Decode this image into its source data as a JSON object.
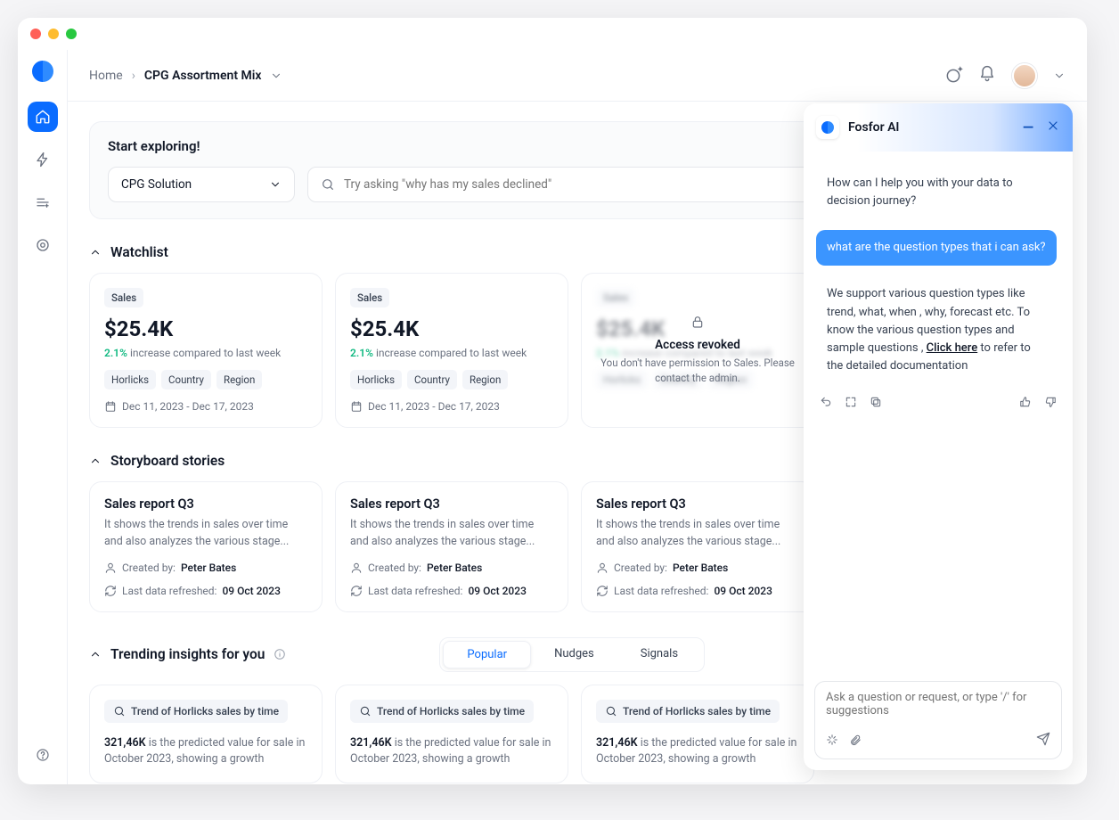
{
  "breadcrumb": {
    "home": "Home",
    "current": "CPG Assortment Mix"
  },
  "explore": {
    "title": "Start exploring!",
    "dropdown_value": "CPG Solution",
    "search_placeholder": "Try asking \"why has my sales declined\""
  },
  "watchlist": {
    "title": "Watchlist",
    "cards": [
      {
        "tag": "Sales",
        "value": "$25.4K",
        "pct": "2.1%",
        "caption": "increase compared to last week",
        "chips": [
          "Horlicks",
          "Country",
          "Region"
        ],
        "dates": "Dec 11, 2023 - Dec 17, 2023"
      },
      {
        "tag": "Sales",
        "value": "$25.4K",
        "pct": "2.1%",
        "caption": "increase compared to last week",
        "chips": [
          "Horlicks",
          "Country",
          "Region"
        ],
        "dates": "Dec 11, 2023 - Dec 17, 2023"
      },
      {
        "tag": "Sales",
        "locked": true,
        "lock_title": "Access revoked",
        "lock_sub": "You don't have permission to Sales. Please contact the admin."
      }
    ]
  },
  "storyboard": {
    "title": "Storyboard stories",
    "cards": [
      {
        "title": "Sales report Q3",
        "desc": "It shows the trends in sales over time and also analyzes the various stage...",
        "created_label": "Created by:",
        "created_by": "Peter Bates",
        "refreshed_label": "Last data refreshed:",
        "refreshed": "09 Oct 2023"
      },
      {
        "title": "Sales report Q3",
        "desc": "It shows the trends in sales over time and also analyzes the various stage...",
        "created_label": "Created by:",
        "created_by": "Peter Bates",
        "refreshed_label": "Last data refreshed:",
        "refreshed": "09 Oct 2023"
      },
      {
        "title": "Sales report Q3",
        "desc": "It shows the trends in sales over time and also analyzes the various stage...",
        "created_label": "Created by:",
        "created_by": "Peter Bates",
        "refreshed_label": "Last data refreshed:",
        "refreshed": "09 Oct 2023"
      }
    ]
  },
  "trending": {
    "title": "Trending insights for you",
    "tabs": [
      "Popular",
      "Nudges",
      "Signals"
    ],
    "cards": [
      {
        "badge": "Trend of Horlicks sales by time",
        "bold": "321,46K",
        "text": "is the predicted value for sale in October 2023, showing a growth"
      },
      {
        "badge": "Trend of Horlicks sales by time",
        "bold": "321,46K",
        "text": "is the predicted value for sale in October 2023, showing a growth"
      },
      {
        "badge": "Trend of Horlicks sales by time",
        "bold": "321,46K",
        "text": "is the predicted value for sale in October 2023, showing a growth"
      }
    ]
  },
  "ai": {
    "title": "Fosfor AI",
    "greeting": "How can I help you with your data to decision journey?",
    "user_msg": "what are the question types that i can ask?",
    "answer_pre": "We support various question types like trend, what, when , why, forecast etc. To know the various question types and sample questions , ",
    "answer_link": "Click here",
    "answer_post": " to refer to the detailed documentation",
    "input_placeholder": "Ask a question or request, or type '/' for suggestions"
  }
}
